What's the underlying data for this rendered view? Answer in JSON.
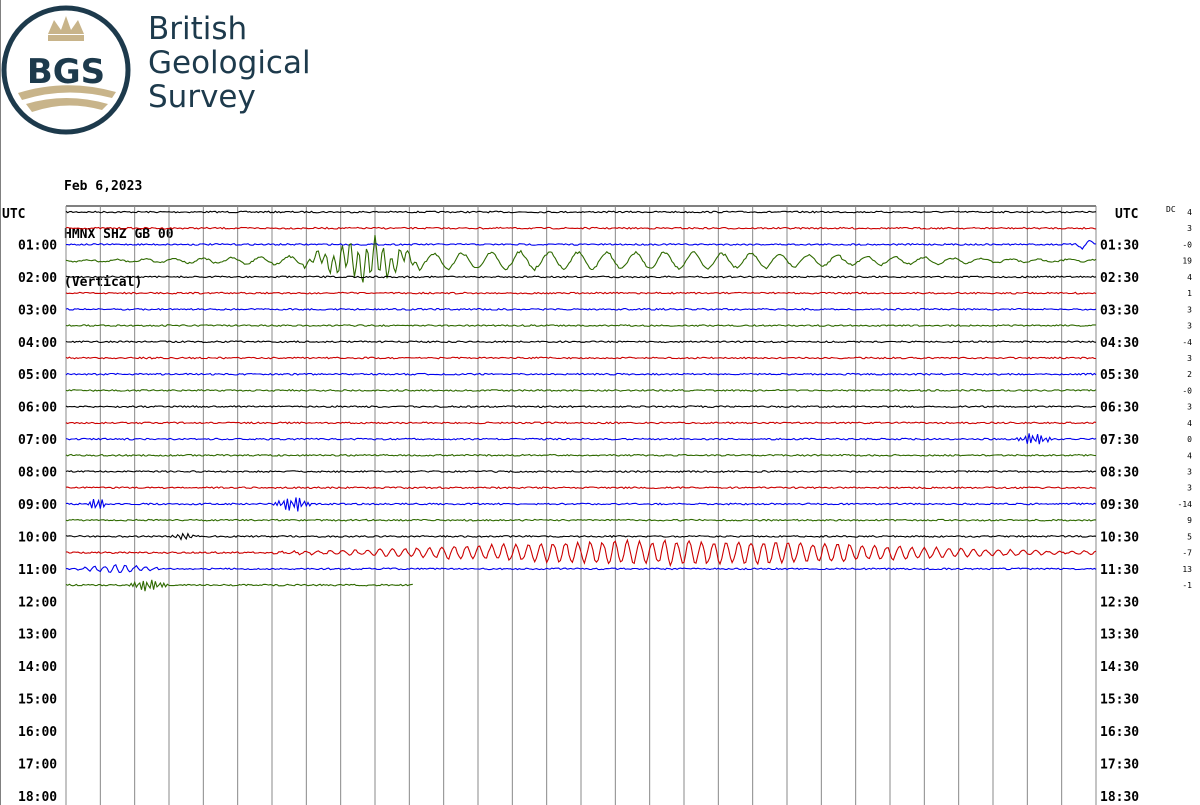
{
  "brand": {
    "badge": "BGS",
    "name_lines": [
      "British",
      "Geological",
      "Survey"
    ],
    "colors": {
      "navy": "#1d3a4c",
      "gold": "#c8b48a"
    }
  },
  "header": {
    "date": "Feb 6,2023",
    "station": "HMNX SHZ GB 00",
    "component": "(Vertical)"
  },
  "chart_data": {
    "type": "line",
    "title": "",
    "left_axis_label": "UTC",
    "right_axis_label": "UTC",
    "dc_label": "DC",
    "left_labels": [
      "01:00",
      "02:00",
      "03:00",
      "04:00",
      "05:00",
      "06:00",
      "07:00",
      "08:00",
      "09:00",
      "10:00",
      "11:00",
      "12:00",
      "13:00",
      "14:00",
      "15:00",
      "16:00",
      "17:00",
      "18:00"
    ],
    "right_labels": [
      "01:30",
      "02:30",
      "03:30",
      "04:30",
      "05:30",
      "06:30",
      "07:30",
      "08:30",
      "09:30",
      "10:30",
      "11:30",
      "12:30",
      "13:30",
      "14:30",
      "15:30",
      "16:30",
      "17:30",
      "18:30"
    ],
    "dc_values": [
      "4",
      "3",
      "-0",
      "19",
      "4",
      "1",
      "3",
      "3",
      "-4",
      "3",
      "2",
      "-0",
      "3",
      "4",
      "0",
      "4",
      "3",
      "3",
      "-14",
      "9",
      "5",
      "-7",
      "13",
      "-1"
    ],
    "trace_colors": [
      "#000000",
      "#cc0000",
      "#0000ee",
      "#2f6a00"
    ],
    "minutes_per_line": 30,
    "vertical_grid_interval_minutes": 1,
    "recorded_lines": 24,
    "last_line_end_fraction": 0.337,
    "events": [
      {
        "line": 3,
        "start": 0.0,
        "end": 1.0,
        "amplitude": 10,
        "period": 0.028
      },
      {
        "line": 3,
        "start": 0.23,
        "end": 0.35,
        "amplitude": 20,
        "period": 0.008
      },
      {
        "line": 2,
        "start": 0.98,
        "end": 1.0,
        "amplitude": 6,
        "period": 0.02
      },
      {
        "line": 14,
        "start": 0.92,
        "end": 0.96,
        "amplitude": 7,
        "period": 0.004
      },
      {
        "line": 18,
        "start": 0.02,
        "end": 0.04,
        "amplitude": 7,
        "period": 0.004
      },
      {
        "line": 18,
        "start": 0.2,
        "end": 0.24,
        "amplitude": 9,
        "period": 0.004
      },
      {
        "line": 20,
        "start": 0.1,
        "end": 0.13,
        "amplitude": 4,
        "period": 0.005
      },
      {
        "line": 21,
        "start": 0.2,
        "end": 1.0,
        "amplitude": 13,
        "period": 0.012
      },
      {
        "line": 22,
        "start": 0.0,
        "end": 0.1,
        "amplitude": 4,
        "period": 0.01
      },
      {
        "line": 23,
        "start": 0.06,
        "end": 0.1,
        "amplitude": 7,
        "period": 0.004
      }
    ]
  }
}
